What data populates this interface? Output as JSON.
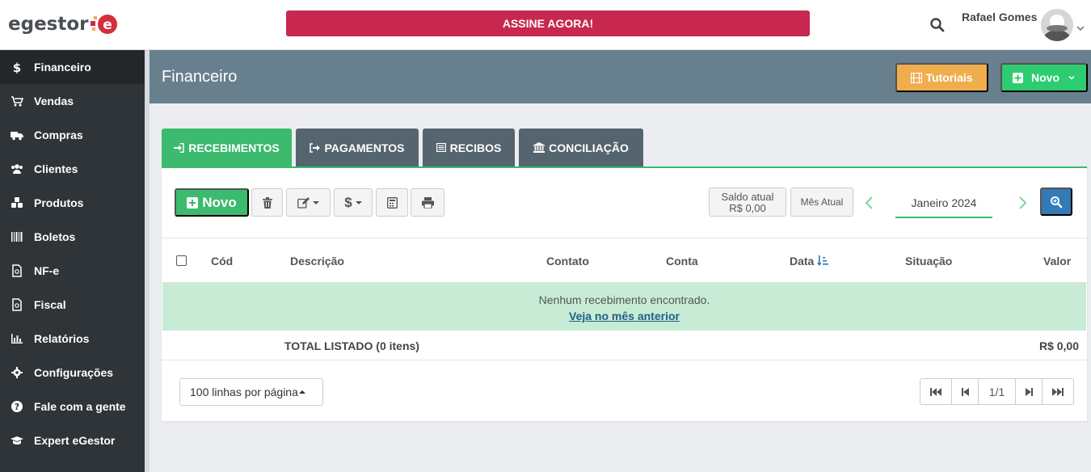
{
  "app": {
    "logo_text": "egestor",
    "cta_label": "ASSINE AGORA!",
    "user_name": "Rafael Gomes"
  },
  "sidebar": {
    "items": [
      {
        "label": "Financeiro",
        "icon": "dollar-icon",
        "active": true
      },
      {
        "label": "Vendas",
        "icon": "cart-icon"
      },
      {
        "label": "Compras",
        "icon": "truck-icon"
      },
      {
        "label": "Clientes",
        "icon": "users-icon"
      },
      {
        "label": "Produtos",
        "icon": "cubes-icon"
      },
      {
        "label": "Boletos",
        "icon": "barcode-icon"
      },
      {
        "label": "NF-e",
        "icon": "document-icon"
      },
      {
        "label": "Fiscal",
        "icon": "document-icon"
      },
      {
        "label": "Relatórios",
        "icon": "bar-chart-icon"
      },
      {
        "label": "Configurações",
        "icon": "gear-icon"
      },
      {
        "label": "Fale com a gente",
        "icon": "question-icon"
      },
      {
        "label": "Expert eGestor",
        "icon": "graduation-cap-icon"
      }
    ]
  },
  "header": {
    "title": "Financeiro",
    "tutoriais_label": "Tutoriais",
    "novo_label": "Novo"
  },
  "tabs": [
    {
      "label": "RECEBIMENTOS",
      "active": true
    },
    {
      "label": "PAGAMENTOS"
    },
    {
      "label": "RECIBOS"
    },
    {
      "label": "CONCILIAÇÃO"
    }
  ],
  "toolbar": {
    "novo_label": "Novo",
    "saldo_label": "Saldo atual",
    "saldo_value": "R$ 0,00",
    "mes_atual_label": "Mês Atual",
    "month": "Janeiro 2024"
  },
  "table": {
    "columns": [
      "Cód",
      "Descrição",
      "Contato",
      "Conta",
      "Data",
      "Situação",
      "Valor"
    ],
    "empty_message": "Nenhum recebimento encontrado.",
    "empty_link": "Veja no mês anterior",
    "total_label": "TOTAL LISTADO (0 itens)",
    "total_value": "R$ 0,00"
  },
  "pagination": {
    "per_page": "100 linhas por página",
    "page": "1/1"
  },
  "colors": {
    "accent_green": "#3cba6e",
    "cta_red": "#c8284f",
    "header_bg": "#687f8e",
    "sidebar_bg": "#2f3438",
    "tutoriais": "#f0ad4e",
    "zoom_blue": "#337ab7"
  }
}
